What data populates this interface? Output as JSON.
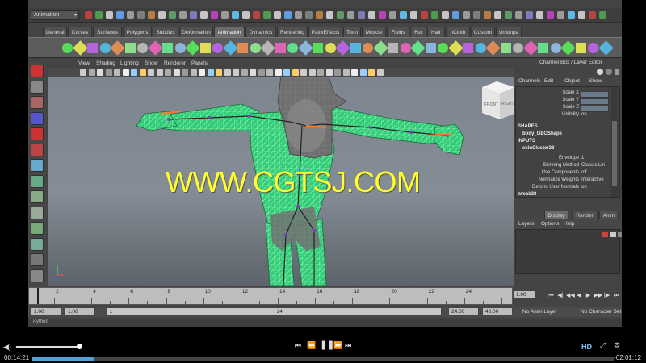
{
  "status_line": {
    "mode": "Animation"
  },
  "shelf": {
    "tabs": [
      "General",
      "Curves",
      "Surfaces",
      "Polygons",
      "Subdivs",
      "Deformation",
      "Animation",
      "Dynamics",
      "Rendering",
      "PaintEffects",
      "Toon",
      "Muscle",
      "Fluids",
      "Fur",
      "Hair",
      "nCloth",
      "Custom",
      "simonpa"
    ],
    "active_tab": "Animation"
  },
  "viewport": {
    "menu": [
      "View",
      "Shading",
      "Lighting",
      "Show",
      "Renderer",
      "Panels"
    ],
    "viewcube_labels": [
      "FRONT",
      "RIGHT"
    ]
  },
  "channel_box": {
    "title": "Channel Box / Layer Editor",
    "menu": [
      "Channels",
      "Edit",
      "Object",
      "Show"
    ],
    "rows": [
      {
        "label": "Scale X",
        "value": ""
      },
      {
        "label": "Scale Y",
        "value": ""
      },
      {
        "label": "Scale Z",
        "value": ""
      },
      {
        "label": "Visibility",
        "value": "on"
      }
    ],
    "shapes_header": "SHAPES",
    "shape_name": "body_GEOShape",
    "inputs_header": "INPUTS",
    "input_name": "skinCluster28",
    "attrs": [
      {
        "label": "Envelope",
        "value": "1"
      },
      {
        "label": "Skinning Method",
        "value": "Classic Lin"
      },
      {
        "label": "Use Components",
        "value": "off"
      },
      {
        "label": "Normalize Weights",
        "value": "Interactive"
      },
      {
        "label": "Deform User Normals",
        "value": "on"
      }
    ],
    "tweak_name": "tweak28"
  },
  "layer_editor": {
    "tabs": [
      "Display",
      "Render",
      "Anim"
    ],
    "active_tab": "Display",
    "menu": [
      "Layers",
      "Options",
      "Help"
    ]
  },
  "time_slider": {
    "ticks": [
      "2",
      "4",
      "6",
      "8",
      "10",
      "12",
      "14",
      "16",
      "18",
      "20",
      "22",
      "24"
    ],
    "current_frame": "1.00"
  },
  "range_slider": {
    "start": "1.00",
    "playback_start": "1.00",
    "handle_start": "1",
    "handle_end": "24",
    "playback_end": "24.00",
    "end": "48.00",
    "anim_layer": "No Anim Layer",
    "character_set": "No Character Set"
  },
  "command_line": {
    "label": "Python"
  },
  "watermark": "WWW.CGTSJ.COM",
  "player": {
    "current_time": "00:14:21",
    "remaining_time": "-02:01:12",
    "progress": 0.105,
    "volume": 0.95,
    "hd_label": "HD",
    "colors": {
      "progress": "#4aa3df",
      "accent": "#7cc4ff",
      "watermark": "#ffff2a",
      "wireframe": "#3cff8a"
    }
  }
}
